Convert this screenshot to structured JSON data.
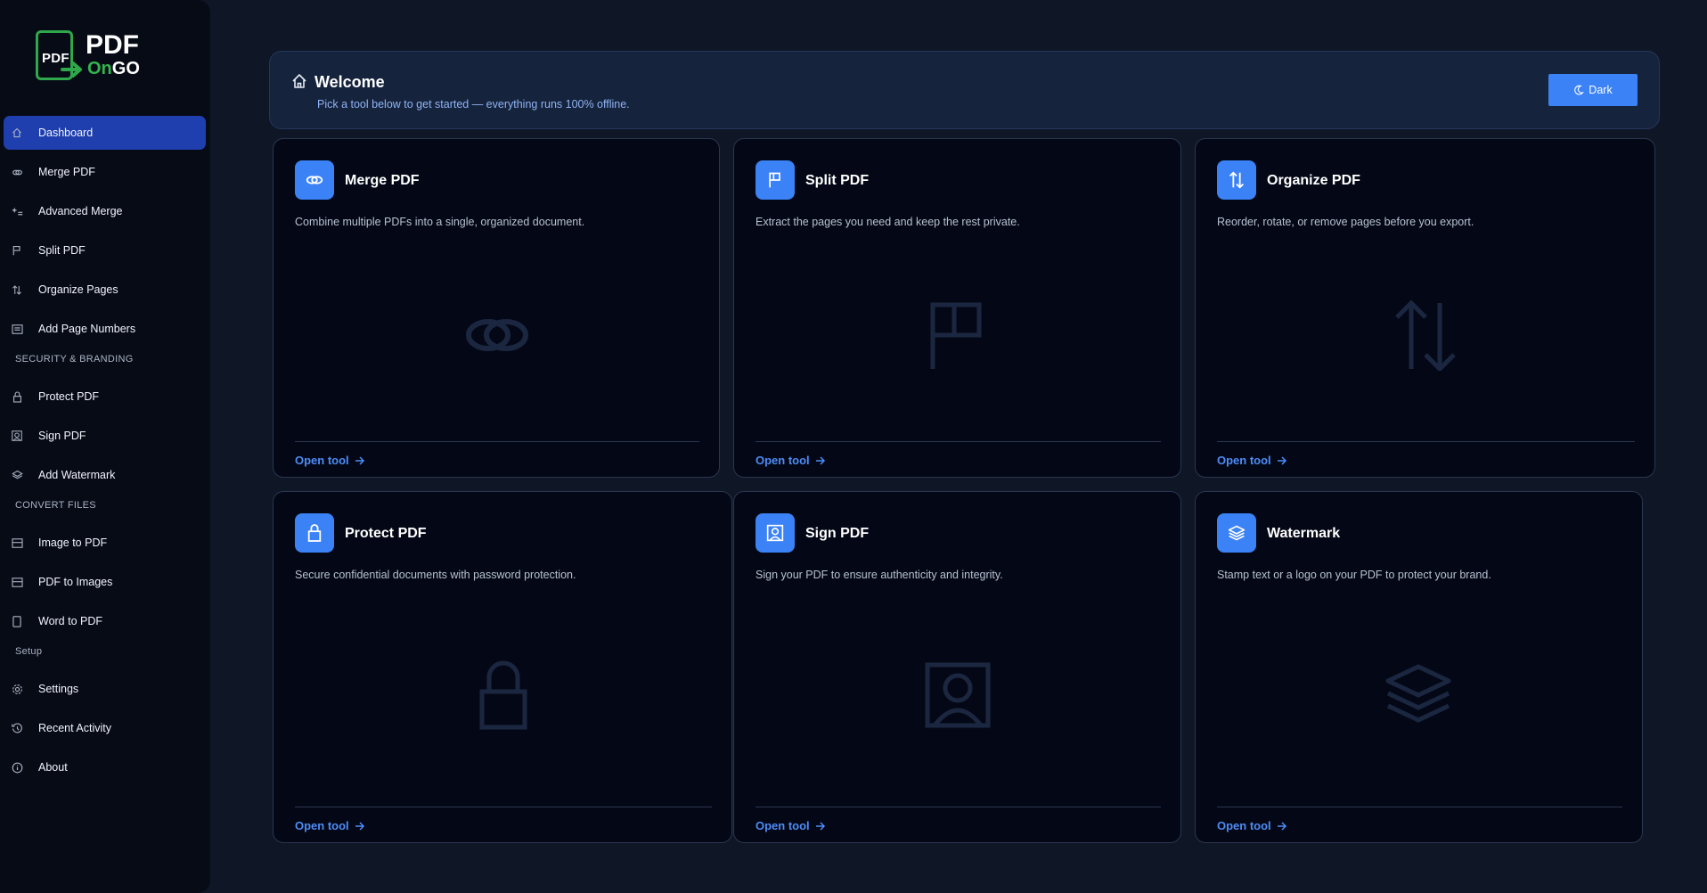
{
  "app": {
    "logo_badge": "PDF",
    "logo_title": "PDF",
    "logo_sub_on": "On",
    "logo_sub_go": "GO"
  },
  "sidebar": {
    "items_main": [
      {
        "label": "Dashboard",
        "icon": "home-icon",
        "active": true
      },
      {
        "label": "Merge PDF",
        "icon": "link-icon"
      },
      {
        "label": "Advanced Merge",
        "icon": "sparkle-list-icon"
      },
      {
        "label": "Split PDF",
        "icon": "flag-icon"
      },
      {
        "label": "Organize Pages",
        "icon": "sort-arrows-icon"
      },
      {
        "label": "Add Page Numbers",
        "icon": "numbered-page-icon"
      }
    ],
    "section_security": "SECURITY & BRANDING",
    "items_security": [
      {
        "label": "Protect PDF",
        "icon": "lock-icon"
      },
      {
        "label": "Sign PDF",
        "icon": "signature-icon"
      },
      {
        "label": "Add Watermark",
        "icon": "layers-icon"
      }
    ],
    "section_convert": "CONVERT FILES",
    "items_convert": [
      {
        "label": "Image to PDF",
        "icon": "image-icon"
      },
      {
        "label": "PDF to Images",
        "icon": "images-icon"
      },
      {
        "label": "Word to PDF",
        "icon": "document-icon"
      }
    ],
    "section_setup": "Setup",
    "items_setup": [
      {
        "label": "Settings",
        "icon": "gear-icon"
      },
      {
        "label": "Recent Activity",
        "icon": "history-icon"
      },
      {
        "label": "About",
        "icon": "info-icon"
      }
    ]
  },
  "welcome": {
    "title": "Welcome",
    "subtitle": "Pick a tool below to get started — everything runs 100% offline.",
    "theme_button": "Dark"
  },
  "cards": [
    {
      "title": "Merge PDF",
      "desc": "Combine multiple PDFs into a single, organized document.",
      "link": "Open tool",
      "icon": "link-icon"
    },
    {
      "title": "Split PDF",
      "desc": "Extract the pages you need and keep the rest private.",
      "link": "Open tool",
      "icon": "flag-icon"
    },
    {
      "title": "Organize PDF",
      "desc": "Reorder, rotate, or remove pages before you export.",
      "link": "Open tool",
      "icon": "sort-arrows-icon"
    },
    {
      "title": "Protect PDF",
      "desc": "Secure confidential documents with password protection.",
      "link": "Open tool",
      "icon": "lock-icon"
    },
    {
      "title": "Sign PDF",
      "desc": "Sign your PDF to ensure authenticity and integrity.",
      "link": "Open tool",
      "icon": "signature-icon"
    },
    {
      "title": "Watermark",
      "desc": "Stamp text or a logo on your PDF to protect your brand.",
      "link": "Open tool",
      "icon": "layers-icon"
    }
  ],
  "colors": {
    "accent": "#3b82f6",
    "active_nav": "#1f3fae",
    "brand_green": "#2ea84a"
  }
}
